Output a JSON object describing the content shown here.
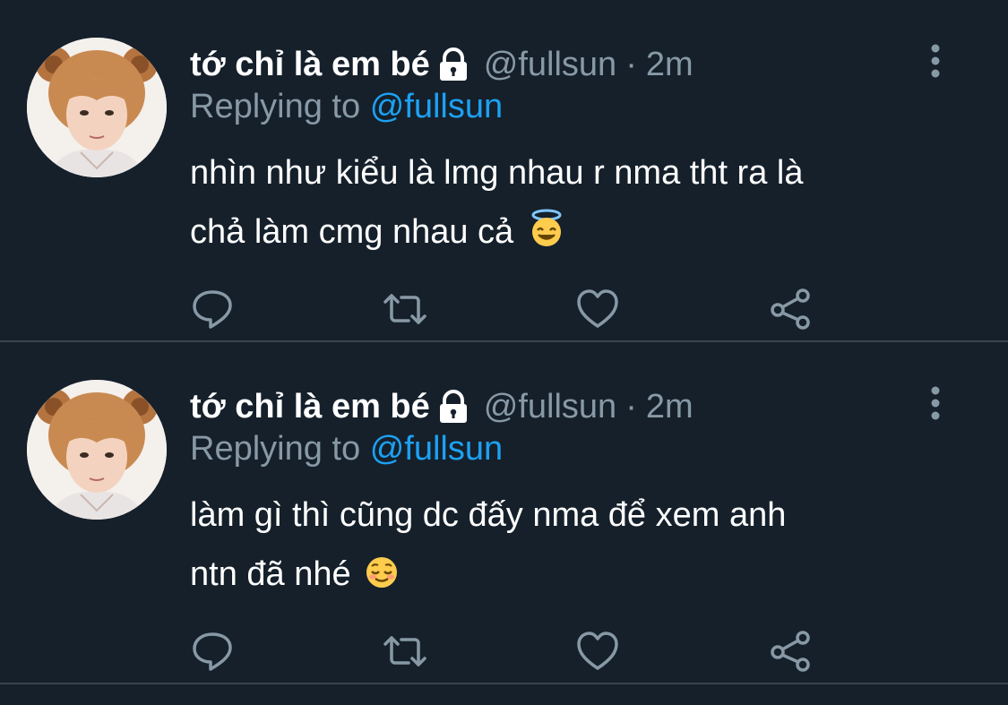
{
  "colors": {
    "background": "#15202b",
    "divider": "#38444d",
    "text_primary": "#ffffff",
    "text_secondary": "#8899a6",
    "accent": "#1da1f2"
  },
  "tweets": [
    {
      "display_name": "tớ chỉ là em bé",
      "handle": "@fullsun",
      "separator": "·",
      "time": "2m",
      "replying_to_label": "Replying to",
      "replying_to_handle": "@fullsun",
      "text_line1": "nhìn như kiểu là lmg nhau r nma tht ra là",
      "text_line2": "chả làm cmg nhau cả",
      "emoji": "smiling-face-with-halo",
      "icons": [
        "lock-icon",
        "more-vertical-icon",
        "reply-icon",
        "retweet-icon",
        "like-icon",
        "share-icon"
      ]
    },
    {
      "display_name": "tớ chỉ là em bé",
      "handle": "@fullsun",
      "separator": "·",
      "time": "2m",
      "replying_to_label": "Replying to",
      "replying_to_handle": "@fullsun",
      "text_line1": "làm gì thì cũng dc đấy nma để xem anh",
      "text_line2": "ntn đã nhé",
      "emoji": "relieved-face",
      "icons": [
        "lock-icon",
        "more-vertical-icon",
        "reply-icon",
        "retweet-icon",
        "like-icon",
        "share-icon"
      ]
    }
  ]
}
